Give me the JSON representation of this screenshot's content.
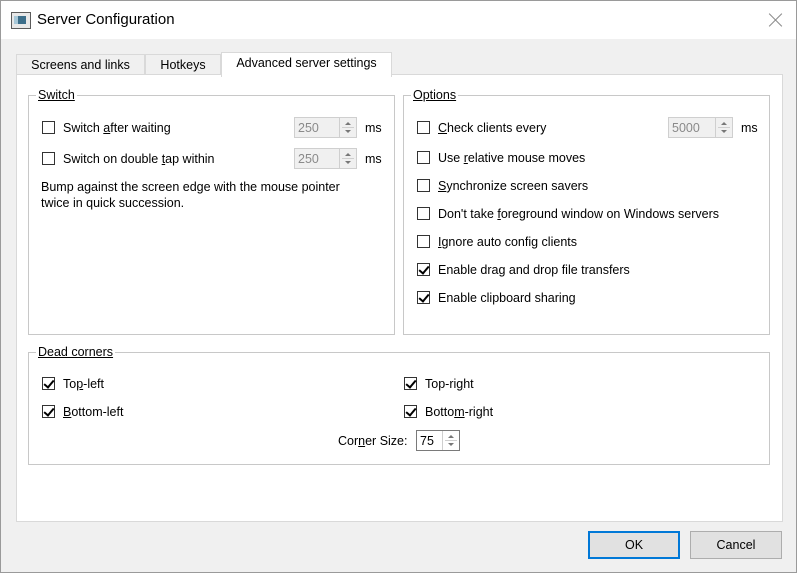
{
  "window": {
    "title": "Server Configuration"
  },
  "tabs": [
    {
      "label": "Screens and links"
    },
    {
      "label": "Hotkeys"
    },
    {
      "label": "Advanced server settings"
    }
  ],
  "switch_group": {
    "title": "Switch",
    "after_waiting": {
      "label_pre": "Switch ",
      "label_key": "a",
      "label_post": "fter waiting",
      "checked": false,
      "value": "250",
      "unit": "ms"
    },
    "double_tap": {
      "label_pre": "Switch on double ",
      "label_key": "t",
      "label_post": "ap within",
      "checked": false,
      "value": "250",
      "unit": "ms"
    },
    "description": "Bump against the screen edge with the mouse pointer twice in quick succession."
  },
  "options_group": {
    "title": "Options",
    "check_clients": {
      "label_key": "C",
      "label_post": "heck clients every",
      "checked": false,
      "value": "5000",
      "unit": "ms"
    },
    "items": [
      {
        "pre": "Use ",
        "key": "r",
        "post": "elative mouse moves",
        "checked": false
      },
      {
        "pre": "",
        "key": "S",
        "post": "ynchronize screen savers",
        "checked": false
      },
      {
        "pre": "Don't take ",
        "key": "f",
        "post": "oreground window on Windows servers",
        "checked": false
      },
      {
        "pre": "",
        "key": "I",
        "post": "gnore auto config clients",
        "checked": false
      },
      {
        "pre": "Enable drag and drop file transfers",
        "key": "",
        "post": "",
        "checked": true
      },
      {
        "pre": "Enable clipboard sharing",
        "key": "",
        "post": "",
        "checked": true
      }
    ]
  },
  "dead_corners": {
    "title": "Dead corners",
    "top_left": {
      "pre": "To",
      "key": "p",
      "post": "-left",
      "checked": true
    },
    "top_right": {
      "pre": "Top-ri",
      "key": "g",
      "post": "ht",
      "checked": true
    },
    "bottom_left": {
      "pre": "",
      "key": "B",
      "post": "ottom-left",
      "checked": true
    },
    "bottom_right": {
      "pre": "Botto",
      "key": "m",
      "post": "-right",
      "checked": true
    },
    "corner_size": {
      "pre": "Cor",
      "key": "n",
      "post": "er Size:",
      "value": "75"
    }
  },
  "buttons": {
    "ok": "OK",
    "cancel": "Cancel"
  }
}
